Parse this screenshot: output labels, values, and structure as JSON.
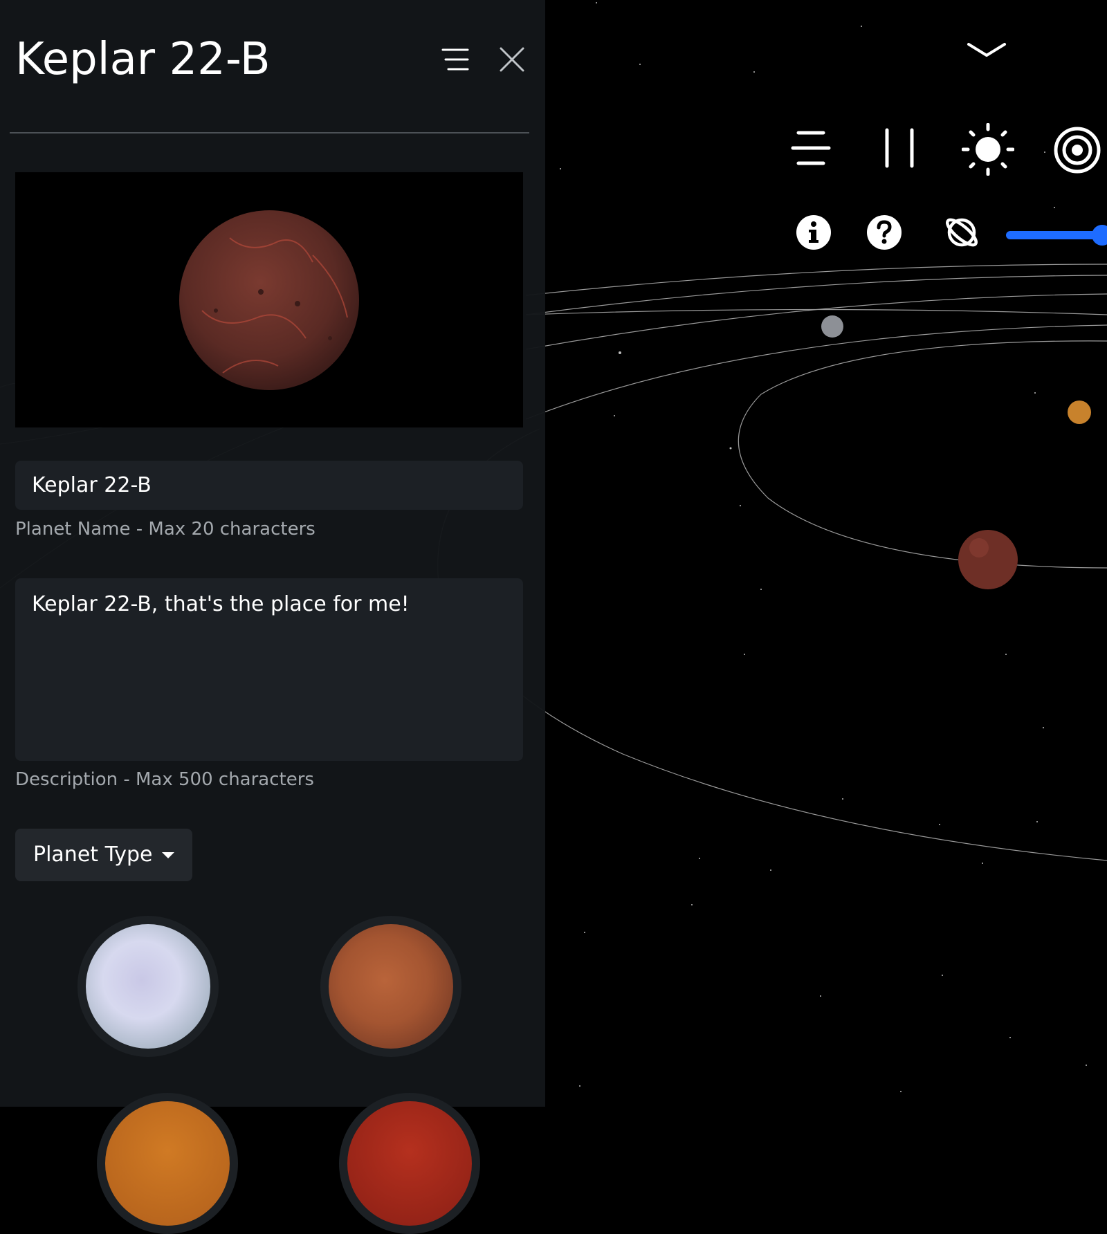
{
  "panel": {
    "title": "Keplar 22-B",
    "name_value": "Keplar 22-B",
    "name_helper": "Planet Name - Max 20 characters",
    "description_value": "Keplar 22-B, that's the place for me!",
    "description_helper": "Description - Max 500 characters",
    "planet_type_label": "Planet Type",
    "header_icons": [
      "menu-icon",
      "close-icon"
    ],
    "planet_swatches": [
      "ice-planet",
      "mars-like-planet",
      "orange-planet",
      "red-planet"
    ]
  },
  "controls": {
    "top_icons": [
      "chevron-down-icon"
    ],
    "row1_icons": [
      "menu-icon",
      "pause-icon",
      "sun-icon",
      "target-icon"
    ],
    "row2_icons": [
      "info-icon",
      "help-icon",
      "planet-orbit-icon"
    ],
    "slider_level": 0.95
  },
  "colors": {
    "accent": "#1e6cff",
    "panel_bg": "#131619",
    "field_bg": "#1c2025"
  }
}
